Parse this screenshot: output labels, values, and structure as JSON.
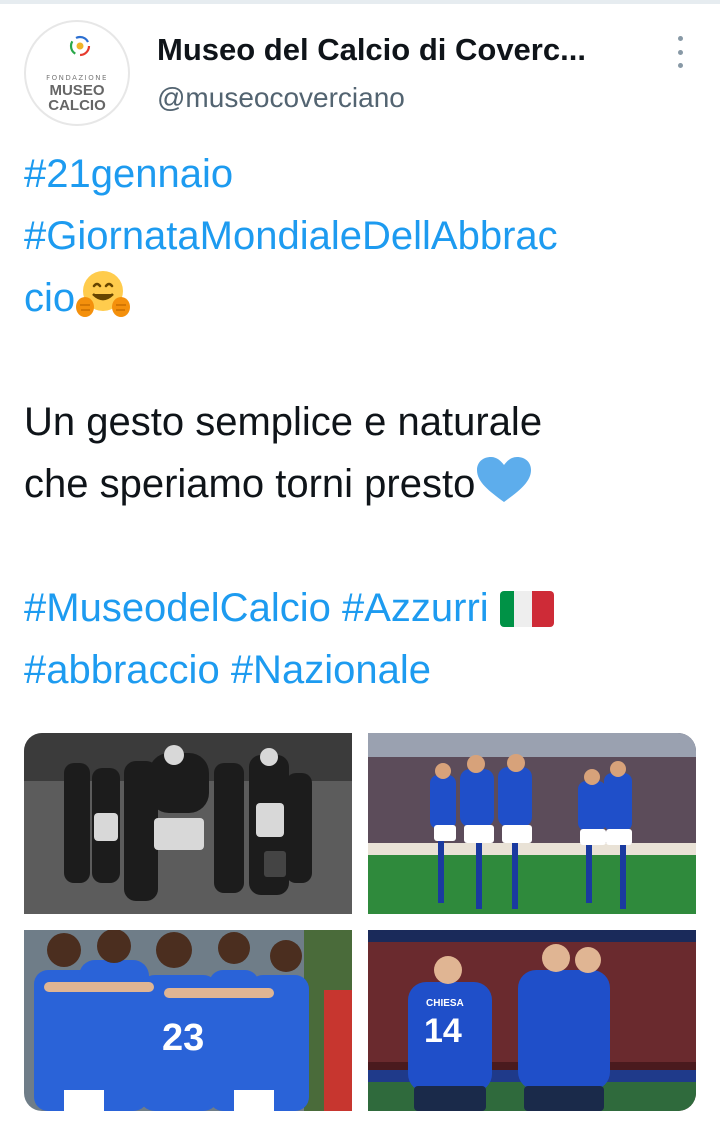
{
  "header": {
    "display_name": "Museo del Calcio di Coverc...",
    "handle": "@museocoverciano",
    "avatar": {
      "line1": "FONDAZIONE",
      "line2": "MUSEO",
      "line3": "CALCIO"
    }
  },
  "tweet": {
    "hashtag_date": "#21gennaio",
    "hashtag_day_part1": "#GiornataMondialeDellAbbrac",
    "hashtag_day_part2": "cio",
    "body_line1": "Un gesto semplice e naturale",
    "body_line2": "che speriamo torni presto",
    "tag_museo": "#MuseodelCalcio",
    "tag_azzurri": "#Azzurri",
    "tag_abbraccio": "#abbraccio",
    "tag_nazionale": "#Nazionale"
  },
  "icons": {
    "more": "more-options-icon",
    "hug_emoji": "hugging-face-icon",
    "heart_emoji": "blue-heart-icon",
    "flag_emoji": "italy-flag-icon"
  },
  "photos": {
    "photo3_jersey": "23",
    "photo4_jersey": "14",
    "photo4_name": "CHIESA"
  },
  "colors": {
    "link": "#1d9bf0",
    "text": "#0f1419",
    "secondary": "#536471",
    "heart": "#5dadec",
    "azzurri": "#1f4fc9"
  }
}
